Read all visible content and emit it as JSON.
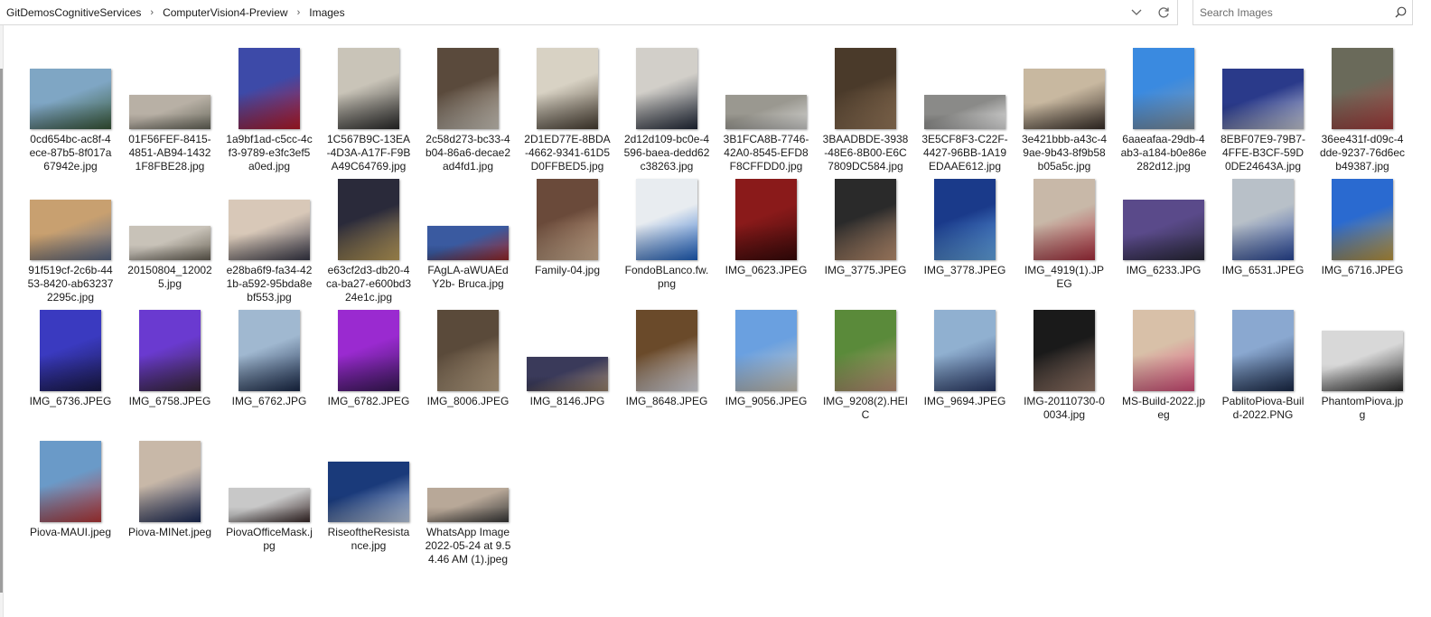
{
  "breadcrumb": [
    "GitDemosCognitiveServices",
    "ComputerVision4-Preview",
    "Images"
  ],
  "search": {
    "placeholder": "Search Images"
  },
  "icons": {
    "dropdown": "chevron-down-icon",
    "refresh": "refresh-icon",
    "search": "search-icon",
    "separator": "chevron-right-icon"
  },
  "files": [
    {
      "name": "0cd654bc-ac8f-4ece-87b5-8f017a67942e.jpg",
      "shape": "wide",
      "c1": "#7fa6c4",
      "c2": "#3a5a3a"
    },
    {
      "name": "01F56FEF-8415-4851-AB94-14321F8FBE28.jpg",
      "shape": "land",
      "c1": "#b8b0a5",
      "c2": "#6a6a5e"
    },
    {
      "name": "1a9bf1ad-c5cc-4cf3-9789-e3fc3ef5a0ed.jpg",
      "shape": "port",
      "c1": "#3d4aa8",
      "c2": "#c01c2a"
    },
    {
      "name": "1C567B9C-13EA-4D3A-A17F-F9BA49C64769.jpg",
      "shape": "port",
      "c1": "#c9c4b8",
      "c2": "#2b2b2b"
    },
    {
      "name": "2c58d273-bc33-4b04-86a6-decae2ad4fd1.jpg",
      "shape": "port",
      "c1": "#5a4a3c",
      "c2": "#d9d3c8"
    },
    {
      "name": "2D1ED77E-8BDA-4662-9341-61D5D0FFBED5.jpg",
      "shape": "port",
      "c1": "#d8d2c4",
      "c2": "#4a4034"
    },
    {
      "name": "2d12d109-bc0e-4596-baea-dedd62c38263.jpg",
      "shape": "port",
      "c1": "#d2cfc9",
      "c2": "#222a3a"
    },
    {
      "name": "3B1FCA8B-7746-42A0-8545-EFD8F8CFFDD0.jpg",
      "shape": "land",
      "c1": "#9a9890",
      "c2": "#d8d8d6"
    },
    {
      "name": "3BAADBDE-3938-48E6-8B00-E6C7809DC584.jpg",
      "shape": "port",
      "c1": "#4a3a2a",
      "c2": "#a08060"
    },
    {
      "name": "3E5CF8F3-C22F-4427-96BB-1A19EDAAE612.jpg",
      "shape": "land",
      "c1": "#8a8a88",
      "c2": "#e8e8e8"
    },
    {
      "name": "3e421bbb-a43c-49ae-9b43-8f9b58b05a5c.jpg",
      "shape": "wide",
      "c1": "#c8b8a0",
      "c2": "#3a302a"
    },
    {
      "name": "6aaeafaa-29db-4ab3-a184-b0e86e282d12.jpg",
      "shape": "port",
      "c1": "#3a8ae0",
      "c2": "#8a9aa8"
    },
    {
      "name": "8EBF07E9-79B7-4FFE-B3CF-59D0DE24643A.jpg",
      "shape": "wide",
      "c1": "#2a3a8a",
      "c2": "#d0d4e0"
    },
    {
      "name": "36ee431f-d09c-4dde-9237-76d6ecb49387.jpg",
      "shape": "port",
      "c1": "#6a6a5a",
      "c2": "#b04040"
    },
    {
      "name": "91f519cf-2c6b-4453-8420-ab632372295c.jpg",
      "shape": "wide",
      "c1": "#c8a070",
      "c2": "#5a6a8a"
    },
    {
      "name": "20150804_120025.jpg",
      "shape": "land",
      "c1": "#c8c2b8",
      "c2": "#6a6458"
    },
    {
      "name": "e28ba6f9-fa34-421b-a592-95bda8ebf553.jpg",
      "shape": "wide",
      "c1": "#d8c8b8",
      "c2": "#3a3a4a"
    },
    {
      "name": "e63cf2d3-db20-4ca-ba27-e600bd324e1c.jpg",
      "shape": "port",
      "c1": "#2a2a3a",
      "c2": "#c8a860"
    },
    {
      "name": "FAgLA-aWUAEdY2b- Bruca.jpg",
      "shape": "land",
      "c1": "#3a5aa0",
      "c2": "#a02a2a"
    },
    {
      "name": "Family-04.jpg",
      "shape": "port",
      "c1": "#6a4a3a",
      "c2": "#e0c0a0"
    },
    {
      "name": "FondoBLanco.fw.png",
      "shape": "port",
      "c1": "#e8ecf0",
      "c2": "#1e64c8"
    },
    {
      "name": "IMG_0623.JPEG",
      "shape": "port",
      "c1": "#8a1a1a",
      "c2": "#3a0a0a"
    },
    {
      "name": "IMG_3775.JPEG",
      "shape": "port",
      "c1": "#2a2a2a",
      "c2": "#c89a78"
    },
    {
      "name": "IMG_3778.JPEG",
      "shape": "port",
      "c1": "#1a3a8a",
      "c2": "#6ab0f0"
    },
    {
      "name": "IMG_4919(1).JPEG",
      "shape": "port",
      "c1": "#c8b8a8",
      "c2": "#b03040"
    },
    {
      "name": "IMG_6233.JPG",
      "shape": "wide",
      "c1": "#5a4a8a",
      "c2": "#2a2a3a"
    },
    {
      "name": "IMG_6531.JPEG",
      "shape": "port",
      "c1": "#b8c0c8",
      "c2": "#2a4aa0"
    },
    {
      "name": "IMG_6716.JPEG",
      "shape": "port",
      "c1": "#2a6ad0",
      "c2": "#c8a040"
    },
    {
      "name": "IMG_6736.JPEG",
      "shape": "port",
      "c1": "#3a3ac0",
      "c2": "#1a1a4a"
    },
    {
      "name": "IMG_6758.JPEG",
      "shape": "port",
      "c1": "#6a3ad0",
      "c2": "#3a2a3a"
    },
    {
      "name": "IMG_6762.JPG",
      "shape": "port",
      "c1": "#a0b8d0",
      "c2": "#1a2a4a"
    },
    {
      "name": "IMG_6782.JPEG",
      "shape": "port",
      "c1": "#9a2ad0",
      "c2": "#3a1a5a"
    },
    {
      "name": "IMG_8006.JPEG",
      "shape": "port",
      "c1": "#5a4a3a",
      "c2": "#c8b090"
    },
    {
      "name": "IMG_8146.JPG",
      "shape": "land",
      "c1": "#3a3a5a",
      "c2": "#a08870"
    },
    {
      "name": "IMG_8648.JPEG",
      "shape": "port",
      "c1": "#6a4a2a",
      "c2": "#e8e8f0"
    },
    {
      "name": "IMG_9056.JPEG",
      "shape": "port",
      "c1": "#6aa0e0",
      "c2": "#d8d0c0"
    },
    {
      "name": "IMG_9208(2).HEIC",
      "shape": "port",
      "c1": "#5a8a3a",
      "c2": "#c89a80"
    },
    {
      "name": "IMG_9694.JPEG",
      "shape": "port",
      "c1": "#90b0d0",
      "c2": "#2a3a6a"
    },
    {
      "name": "IMG-20110730-00034.jpg",
      "shape": "port",
      "c1": "#1a1a1a",
      "c2": "#a08070"
    },
    {
      "name": "MS-Build-2022.jpeg",
      "shape": "port",
      "c1": "#d8c0a8",
      "c2": "#e05080"
    },
    {
      "name": "PablitoPiova-Build-2022.PNG",
      "shape": "port",
      "c1": "#8aa8d0",
      "c2": "#1a2a4a"
    },
    {
      "name": "PhantomPiova.jpg",
      "shape": "wide",
      "c1": "#d8d8d8",
      "c2": "#2a2a2a"
    },
    {
      "name": "Piova-MAUI.jpeg",
      "shape": "port",
      "c1": "#6a9ac8",
      "c2": "#c03a3a"
    },
    {
      "name": "Piova-MINet.jpeg",
      "shape": "port",
      "c1": "#c8b8a8",
      "c2": "#1a2a5a"
    },
    {
      "name": "PiovaOfficeMask.jpg",
      "shape": "land",
      "c1": "#c8c8c8",
      "c2": "#3a2a2a"
    },
    {
      "name": "RiseoftheResistance.jpg",
      "shape": "wide",
      "c1": "#1a3a7a",
      "c2": "#c8d8f0"
    },
    {
      "name": "WhatsApp Image 2022-05-24 at 9.54.46 AM (1).jpeg",
      "shape": "land",
      "c1": "#b8a898",
      "c2": "#3a3a3a"
    }
  ]
}
